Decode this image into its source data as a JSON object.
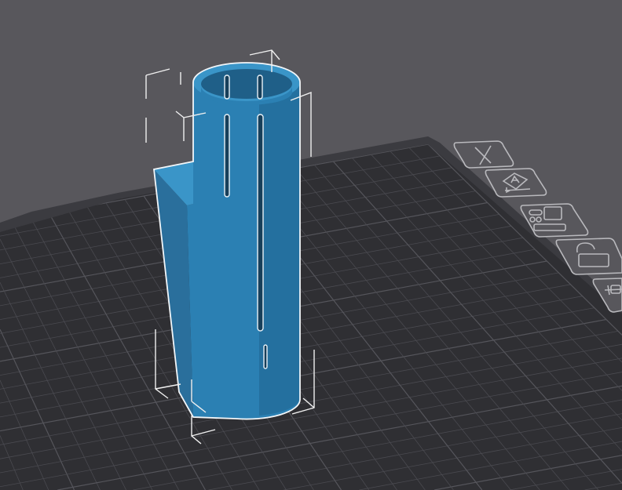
{
  "viewport": {
    "background_color": "#58575c",
    "plate_color": "#2f2f33",
    "grid_color": "#4a4a50",
    "model_color": "#2b80b3",
    "selection_color": "#ffffff"
  },
  "plate_toolbar": [
    {
      "icon": "close-icon"
    },
    {
      "icon": "auto-orient-icon"
    },
    {
      "icon": "arrange-icon"
    },
    {
      "icon": "lock-icon"
    },
    {
      "icon": "plate-settings-icon"
    }
  ]
}
